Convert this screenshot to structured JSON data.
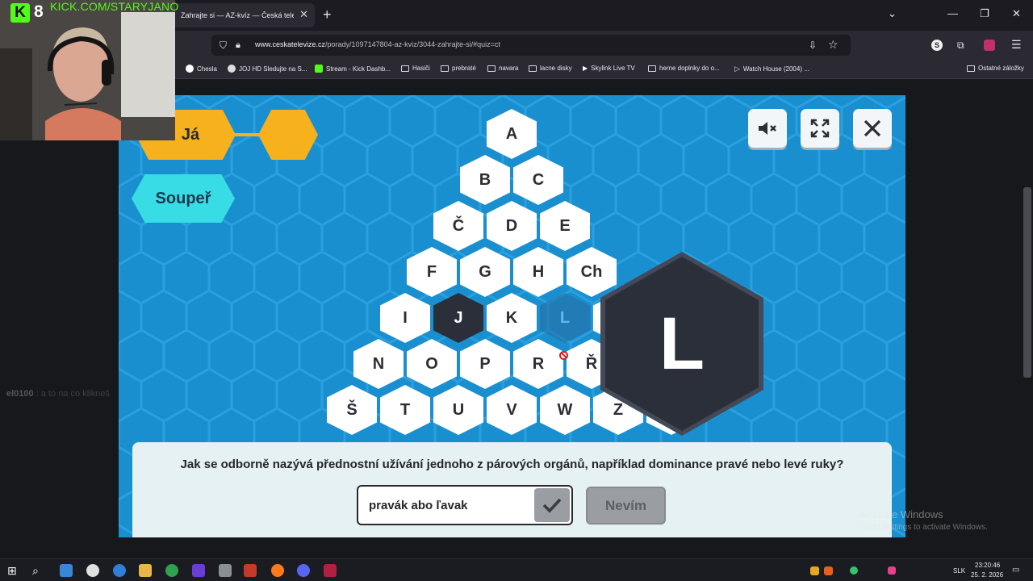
{
  "browser": {
    "tab_title": "Zahrajte si — AZ-kvíz — Česká televize",
    "new_tab_label": "+",
    "url_host": "www.ceskatelevize.cz",
    "url_path": "/porady/1097147804-az-kviz/3044-zahrajte-si/#quiz=ct",
    "profile_letter": "S",
    "bookmarks": [
      {
        "label": "Chesla",
        "icon": "google-icon"
      },
      {
        "label": "JOJ HD Sledujte na S...",
        "icon": "site-icon"
      },
      {
        "label": "Stream - Kick Dashb...",
        "icon": "kick-icon"
      },
      {
        "label": "Hasiči",
        "icon": "folder-icon"
      },
      {
        "label": "prebraté",
        "icon": "folder-icon"
      },
      {
        "label": "navara",
        "icon": "folder-icon"
      },
      {
        "label": "lacne disky",
        "icon": "folder-icon"
      },
      {
        "label": "Skylink Live TV",
        "icon": "play-icon"
      },
      {
        "label": "herne doplnky do o...",
        "icon": "folder-icon"
      },
      {
        "label": "Watch House (2004) ...",
        "icon": "play-circle-icon"
      }
    ],
    "other_bookmarks": "Ostatné záložky"
  },
  "game": {
    "player_me": "Já",
    "player_opponent": "Soupeř",
    "selected_letter": "L",
    "rows": [
      [
        "A"
      ],
      [
        "B",
        "C"
      ],
      [
        "Č",
        "D",
        "E"
      ],
      [
        "F",
        "G",
        "H",
        "Ch"
      ],
      [
        "I",
        "J",
        "K",
        "L",
        ""
      ],
      [
        "N",
        "O",
        "P",
        "R",
        "Ř",
        ""
      ],
      [
        "Š",
        "T",
        "U",
        "V",
        "W",
        "Z",
        ""
      ]
    ],
    "question": "Jak se odborně nazývá přednostní užívání jednoho z párových orgánů, například dominance pravé nebo levé ruky?",
    "answer_value": "pravák abo ľavak",
    "dont_know_label": "Nevím",
    "colors": {
      "game_bg": "#1a8fd0",
      "me": "#f6b11c",
      "opponent": "#37dce5",
      "dark_hex": "#2b2f3a"
    }
  },
  "stream": {
    "viewers": "8",
    "kick_url": "KICK.COM/STARYJANO",
    "chat_user": "el0100",
    "chat_msg": "a to na co klikneš"
  },
  "watermark": {
    "title": "Activate Windows",
    "subtitle": "Go to Settings to activate Windows."
  },
  "taskbar": {
    "lang": "SLK",
    "time": "23:20:46",
    "date": "25. 2. 2026"
  }
}
